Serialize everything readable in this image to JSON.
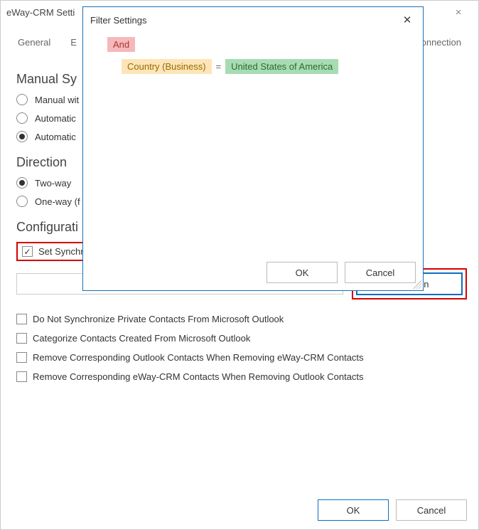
{
  "window": {
    "title": "eWay-CRM Setti"
  },
  "tabs": {
    "general": "General",
    "second_prefix": "E",
    "last": "onnection"
  },
  "sections": {
    "manual_sync_title": "Manual Sy",
    "direction_title": "Direction",
    "config_title": "Configurati"
  },
  "radios": {
    "manual": "Manual wit",
    "auto1": "Automatic",
    "auto2": "Automatic",
    "twoway": "Two-way",
    "oneway": "One-way (f"
  },
  "checks": {
    "set_condition": "Set Synchronization Condition From eWay-CRM to Microsoft Outlook",
    "no_private": "Do Not Synchronize Private Contacts From Microsoft Outlook",
    "categorize": "Categorize Contacts Created From Microsoft Outlook",
    "remove_outlook": "Remove Corresponding Outlook Contacts When Removing eWay-CRM Contacts",
    "remove_eway": "Remove Corresponding eWay-CRM Contacts When Removing Outlook Contacts"
  },
  "buttons": {
    "condition": "Condition",
    "ok": "OK",
    "cancel": "Cancel"
  },
  "dialog": {
    "title": "Filter Settings",
    "operator_tag": "And",
    "field": "Country (Business)",
    "comparison": "=",
    "value": "United States of America",
    "ok": "OK",
    "cancel": "Cancel"
  }
}
